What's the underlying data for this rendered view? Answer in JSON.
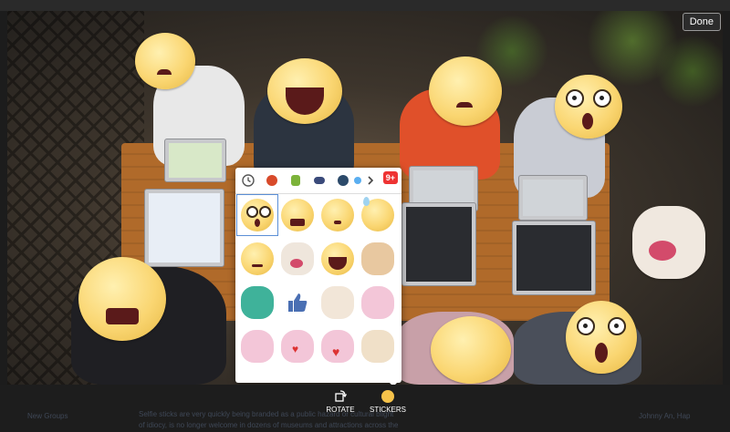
{
  "header": {
    "done_label": "Done"
  },
  "toolbar": {
    "rotate_label": "ROTATE",
    "stickers_label": "STICKERS"
  },
  "sticker_panel": {
    "badge": "9+",
    "tabs": [
      "recent-icon",
      "pack-1-icon",
      "pack-2-icon",
      "pack-3-icon",
      "pack-4-icon",
      "more-chevron-icon"
    ],
    "selected_index": 0
  },
  "background_text": {
    "left_item": "New Groups",
    "middle_line1": "Selfie sticks are very quickly being branded as a public hazard or cultural blight",
    "middle_line2": "of idiocy, is no longer welcome in dozens of museums and attractions across the",
    "right_item": "Johnny An, Hap"
  },
  "colors": {
    "accent": "#5b8fd6",
    "badge": "#e33333",
    "panel_bg": "#ffffff"
  }
}
